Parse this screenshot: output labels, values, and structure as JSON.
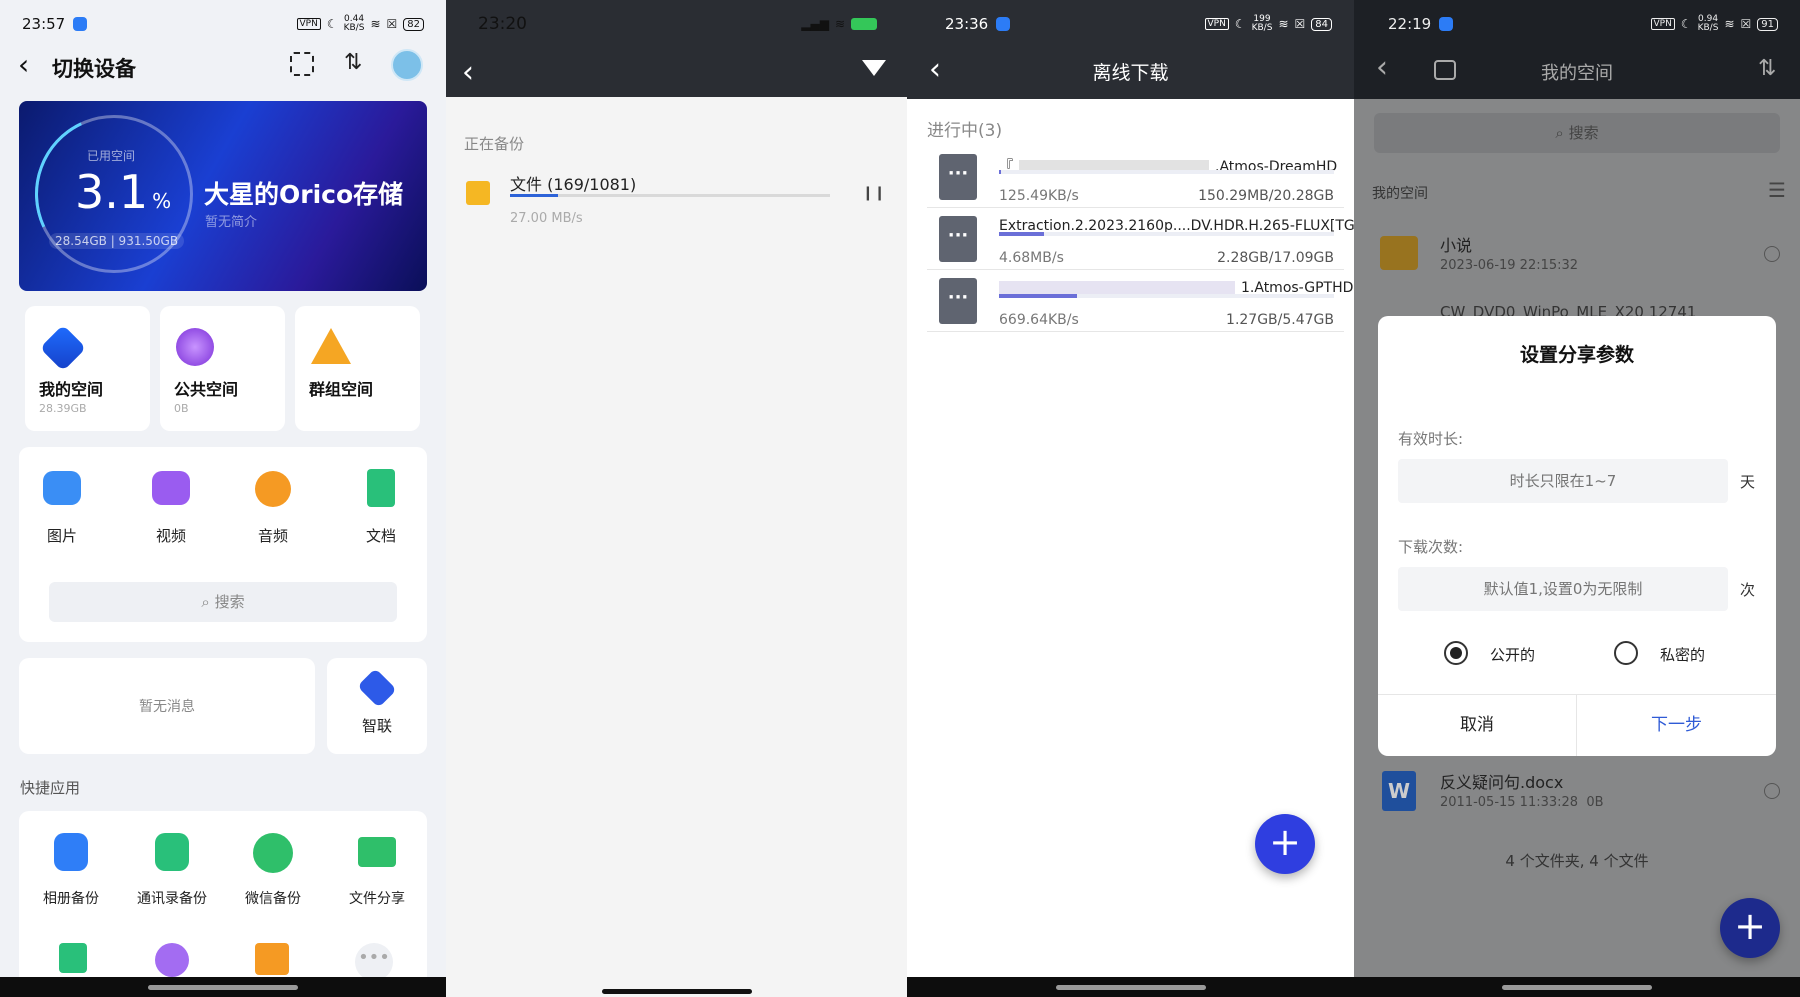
{
  "p1": {
    "time": "23:57",
    "vpn": "VPN",
    "speed": "0.44",
    "speed_unit": "KB/S",
    "battery": "82",
    "title": "切换设备",
    "banner": {
      "used_label": "已用空间",
      "percent": "3.1",
      "percent_sign": "%",
      "capacity": "28.54GB | 931.50GB",
      "name": "大星的Orico存储",
      "desc": "暂无简介"
    },
    "spaces": [
      {
        "label": "我的空间",
        "size": "28.39GB"
      },
      {
        "label": "公共空间",
        "size": "0B"
      },
      {
        "label": "群组空间",
        "size": ""
      }
    ],
    "categories": [
      "图片",
      "视频",
      "音频",
      "文档"
    ],
    "search_placeholder": "搜索",
    "no_message": "暂无消息",
    "zhilian": "智联",
    "quick_title": "快捷应用",
    "quick_apps": [
      "相册备份",
      "通讯录备份",
      "微信备份",
      "文件分享"
    ]
  },
  "p2": {
    "time": "23:20",
    "section": "正在备份",
    "file_label": "文件 (169/1081)",
    "progress": 0.15,
    "speed": "27.00 MB/s"
  },
  "p3": {
    "time": "23:36",
    "vpn": "VPN",
    "speed": "199",
    "speed_unit": "KB/S",
    "battery": "84",
    "title": "离线下载",
    "section": "进行中(3)",
    "items": [
      {
        "name": "『",
        "name_end": ".Atmos-DreamHD",
        "speed": "125.49KB/s",
        "size": "150.29MB/20.28GB",
        "progress": 0.007
      },
      {
        "name": "Extraction.2.2023.2160p....DV.HDR.H.265-FLUX[TGx]",
        "name_end": "",
        "speed": "4.68MB/s",
        "size": "2.28GB/17.09GB",
        "progress": 0.133
      },
      {
        "name": "",
        "name_end": "1.Atmos-GPTHD",
        "speed": "669.64KB/s",
        "size": "1.27GB/5.47GB",
        "progress": 0.232
      }
    ],
    "fab": "+"
  },
  "p4": {
    "time": "22:19",
    "vpn": "VPN",
    "speed": "0.94",
    "speed_unit": "KB/S",
    "battery": "91",
    "title": "我的空间",
    "search_placeholder": "搜索",
    "breadcrumb": "我的空间",
    "folder1": {
      "name": "小说",
      "date": "2023-06-19 22:15:32"
    },
    "folder2_partial": "CW_DVD0_WinPo_MLE_X20 12741",
    "dialog": {
      "title": "设置分享参数",
      "duration_label": "有效时长:",
      "duration_placeholder": "时长只限在1~7",
      "duration_unit": "天",
      "count_label": "下载次数:",
      "count_placeholder": "默认值1,设置0为无限制",
      "count_unit": "次",
      "public": "公开的",
      "private": "私密的",
      "cancel": "取消",
      "next": "下一步"
    },
    "doc": {
      "name": "反义疑问句.docx",
      "date": "2011-05-15 11:33:28",
      "size": "0B",
      "badge": "W"
    },
    "summary": "4 个文件夹, 4 个文件",
    "fab": "+"
  },
  "colors": {
    "accent": "#2f3ee0",
    "link": "#2f5bd6",
    "folder": "#f5b723"
  }
}
